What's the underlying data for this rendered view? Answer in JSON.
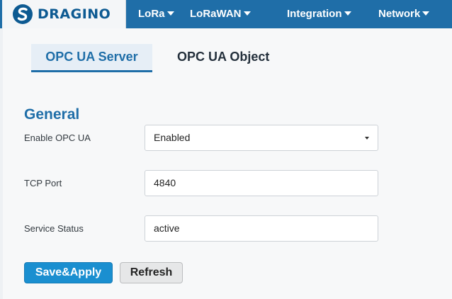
{
  "brand": {
    "logo_text": "DRAGINO",
    "logo_icon": "dragino-logo-icon"
  },
  "nav": {
    "items": [
      {
        "label": "LoRa",
        "icon": "caret-down-icon"
      },
      {
        "label": "LoRaWAN",
        "icon": "caret-down-icon"
      },
      {
        "label": "Integration",
        "icon": "caret-down-icon"
      },
      {
        "label": "Network",
        "icon": "caret-down-icon"
      }
    ]
  },
  "tabs": [
    {
      "label": "OPC UA Server",
      "active": true
    },
    {
      "label": "OPC UA Object",
      "active": false
    }
  ],
  "section": {
    "title": "General"
  },
  "fields": {
    "enable": {
      "label": "Enable OPC UA",
      "value": "Enabled"
    },
    "tcp_port": {
      "label": "TCP Port",
      "value": "4840"
    },
    "status": {
      "label": "Service Status",
      "value": "active"
    }
  },
  "buttons": {
    "save_apply": "Save&Apply",
    "refresh": "Refresh"
  },
  "colors": {
    "nav_bg": "#1f6ea8",
    "accent": "#1f6ea8",
    "primary_button": "#1a8fd0",
    "panel_bg": "#f7f8f9"
  }
}
